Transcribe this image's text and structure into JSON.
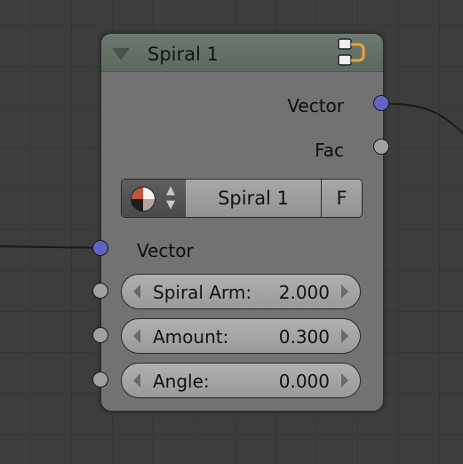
{
  "node": {
    "title": "Spiral 1",
    "outputs": [
      {
        "label": "Vector",
        "socket_color": "#6363c7"
      },
      {
        "label": "Fac",
        "socket_color": "#a1a1a1"
      }
    ],
    "datablock": {
      "name": "Spiral 1",
      "fake_user_label": "F"
    },
    "inputs": [
      {
        "label": "Vector",
        "socket_color": "#6363c7"
      }
    ],
    "fields": [
      {
        "label": "Spiral Arm:",
        "value": "2.000"
      },
      {
        "label": "Amount:",
        "value": "0.300"
      },
      {
        "label": "Angle:",
        "value": "0.000"
      }
    ]
  },
  "colors": {
    "background": "#3d3d3d",
    "node_body": "#727272",
    "node_header": "#5d695f",
    "vector_socket": "#6363c7",
    "float_socket": "#a1a1a1"
  }
}
